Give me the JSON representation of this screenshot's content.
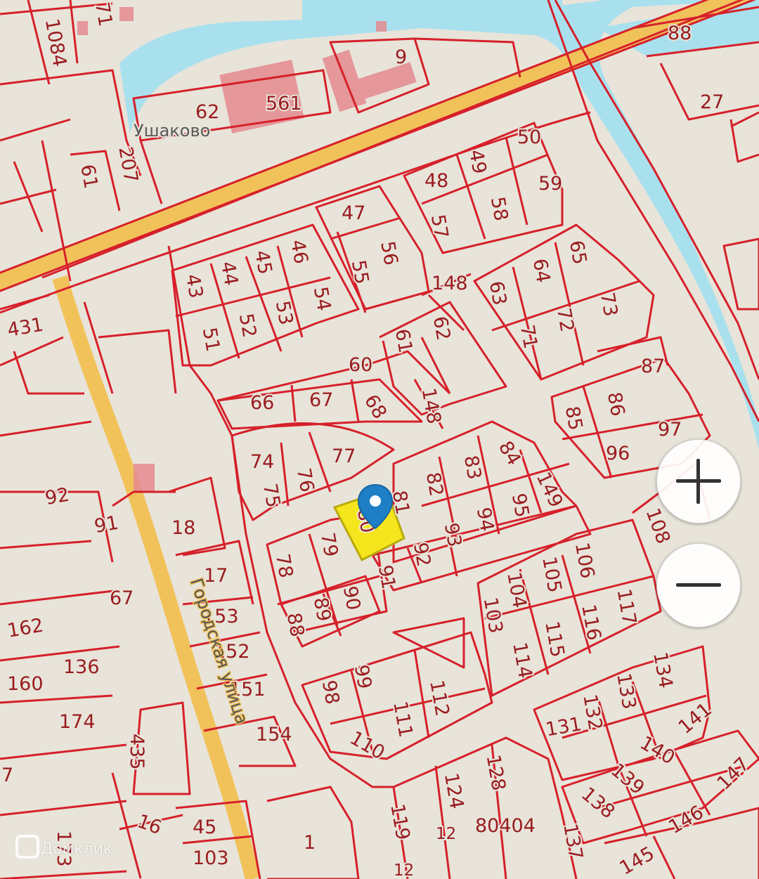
{
  "map": {
    "place_name": "Ушаково",
    "street_name": "Городская улица",
    "watermark": "Домклик",
    "cadastral_block": "80404",
    "selected_parcel": "80",
    "parcels": {
      "p1084": "1084",
      "p71": "71",
      "p9": "9",
      "p88top": "88",
      "p62top": "62",
      "p561": "561",
      "p27": "27",
      "p61left": "61",
      "p207": "207",
      "p50": "50",
      "p48": "48",
      "p49": "49",
      "p59": "59",
      "p57": "57",
      "p58": "58",
      "p47": "47",
      "p56": "56",
      "p46": "46",
      "p45": "45",
      "p44": "44",
      "p43": "43",
      "p55": "55",
      "p148a": "148",
      "p65": "65",
      "p64": "64",
      "p63": "63",
      "p73": "73",
      "p431": "431",
      "p54": "54",
      "p53": "53",
      "p52": "52",
      "p51": "51",
      "p61": "61",
      "p62": "62",
      "p72": "72",
      "p71b": "71",
      "p60": "60",
      "p87": "87",
      "p66": "66",
      "p67": "67",
      "p68": "68",
      "p148b": "148",
      "p85": "85",
      "p86": "86",
      "p97": "97",
      "p96": "96",
      "p74": "74",
      "p77": "77",
      "p76": "76",
      "p84": "84",
      "p83": "83",
      "p82": "82",
      "p149": "149",
      "p75": "75",
      "p81": "81",
      "p95": "95",
      "p94": "94",
      "p93": "93",
      "p92left": "92",
      "p91left": "91",
      "p18": "18",
      "p108": "108",
      "p79": "79",
      "p78": "78",
      "p92": "92",
      "p91": "91",
      "p106": "106",
      "p105": "105",
      "p104": "104",
      "p17": "17",
      "p67left": "67",
      "p90": "90",
      "p89": "89",
      "p88": "88",
      "p103": "103",
      "p117": "117",
      "p116": "116",
      "p115": "115",
      "p153": "153",
      "p162": "162",
      "p152": "152",
      "p136": "136",
      "p114": "114",
      "p134": "134",
      "p160": "160",
      "p99": "99",
      "p98": "98",
      "p112": "112",
      "p133": "133",
      "p151": "151",
      "p174": "174",
      "p111": "111",
      "p131": "131",
      "p132": "132",
      "p141": "141",
      "p154": "154",
      "p435": "435",
      "p110": "110",
      "p140": "140",
      "p147": "147",
      "p7": "7",
      "p124": "124",
      "p128": "128",
      "p139": "139",
      "p138": "138",
      "p119": "119",
      "p146": "146",
      "p16": "16",
      "p45b": "45",
      "p1": "1",
      "p137": "137",
      "p173": "173",
      "p103b": "103",
      "p145": "145",
      "p12a": "12",
      "p12b": "12"
    }
  },
  "controls": {
    "zoom_in_icon": "plus-icon",
    "zoom_out_icon": "minus-icon"
  },
  "colors": {
    "background": "#e8e4da",
    "water": "#a9e0ee",
    "boundary": "#d6202a",
    "road": "#f2c25a",
    "selected": "#f5e51c",
    "marker": "#1f7fc6"
  }
}
